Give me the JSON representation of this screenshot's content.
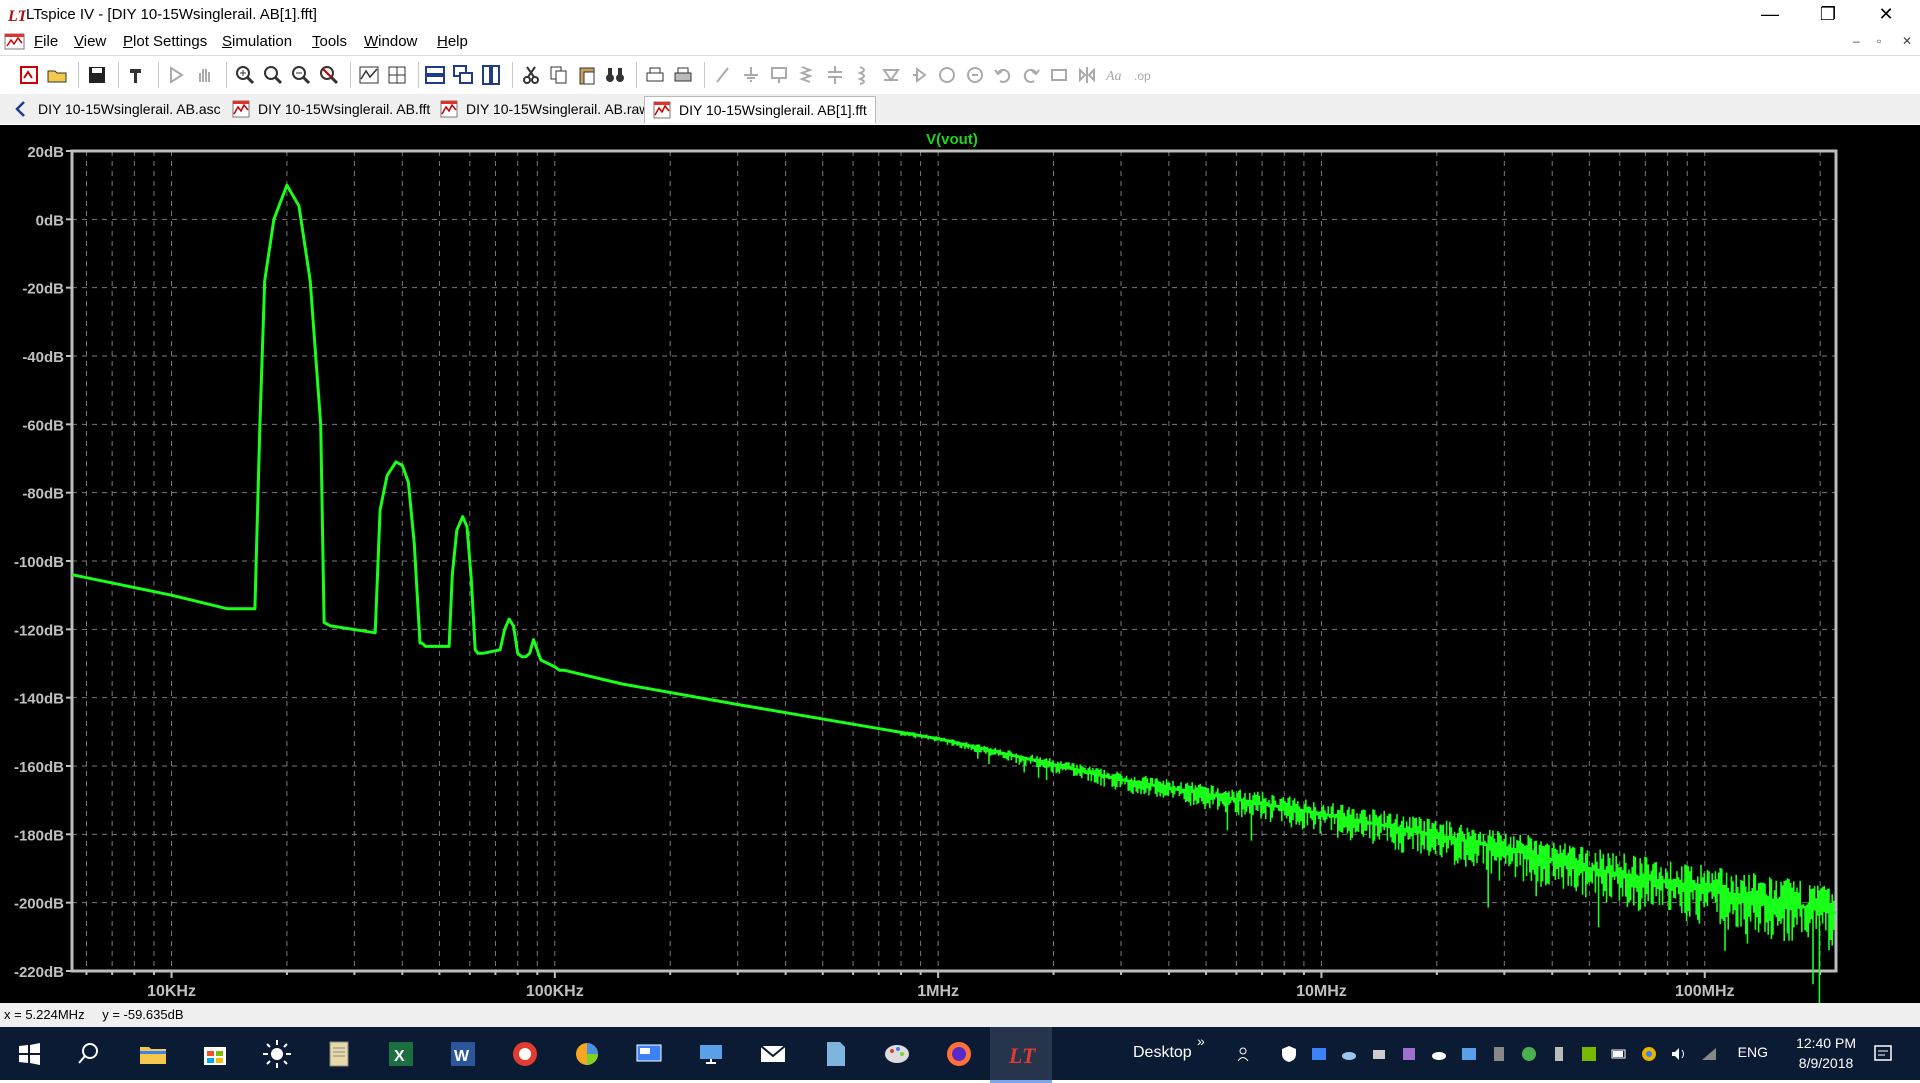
{
  "window": {
    "title": "LTspice IV - [DIY 10-15Wsinglerail. AB[1].fft]",
    "minimize": "—",
    "restore": "❐",
    "close": "✕"
  },
  "menu": {
    "items": [
      {
        "accel": "F",
        "rest": "ile"
      },
      {
        "accel": "V",
        "rest": "iew"
      },
      {
        "accel": "P",
        "rest": "lot Settings"
      },
      {
        "accel": "S",
        "rest": "imulation"
      },
      {
        "accel": "T",
        "rest": "ools"
      },
      {
        "accel": "W",
        "rest": "indow"
      },
      {
        "accel": "H",
        "rest": "elp"
      }
    ],
    "mdi_min": "–",
    "mdi_restore": "▫",
    "mdi_close": "✕"
  },
  "tabs": [
    {
      "label": "DIY 10-15Wsinglerail. AB.asc",
      "icon": "schematic-icon"
    },
    {
      "label": "DIY 10-15Wsinglerail. AB.fft",
      "icon": "waveform-icon"
    },
    {
      "label": "DIY 10-15Wsinglerail. AB.raw",
      "icon": "waveform-icon"
    },
    {
      "label": "DIY 10-15Wsinglerail. AB[1].fft",
      "icon": "waveform-icon",
      "active": true
    }
  ],
  "colors": {
    "trace": "#1aff1a",
    "trace_label": "#1fd21f",
    "grid": "#7a7a7a",
    "axis_text": "#c0c0c0",
    "plot_bg": "#000000"
  },
  "chart_data": {
    "type": "line",
    "title": "V(vout)",
    "xlabel": "",
    "ylabel": "",
    "x_scale": "log",
    "xlim": [
      5500,
      220000000
    ],
    "ylim": [
      -220,
      20
    ],
    "y_ticks": [
      "20dB",
      "0dB",
      "-20dB",
      "-40dB",
      "-60dB",
      "-80dB",
      "-100dB",
      "-120dB",
      "-140dB",
      "-160dB",
      "-180dB",
      "-200dB",
      "-220dB"
    ],
    "x_ticks": [
      {
        "value": 10000,
        "label": "10KHz"
      },
      {
        "value": 100000,
        "label": "100KHz"
      },
      {
        "value": 1000000,
        "label": "1MHz"
      },
      {
        "value": 10000000,
        "label": "10MHz"
      },
      {
        "value": 100000000,
        "label": "100MHz"
      }
    ],
    "grid": true,
    "series": [
      {
        "name": "V(vout)",
        "x": [
          5500,
          10000,
          14000,
          16500,
          17000,
          17500,
          18500,
          20000,
          21500,
          23000,
          24500,
          25000,
          26000,
          34000,
          35000,
          36500,
          38500,
          40000,
          41500,
          43000,
          44500,
          45000,
          46000,
          53000,
          54000,
          55500,
          57500,
          59000,
          60500,
          62000,
          63000,
          64000,
          65000,
          72000,
          74000,
          76000,
          78000,
          80000,
          82000,
          84000,
          86000,
          88000,
          92000,
          96000,
          100000,
          103000,
          106000,
          150000,
          300000,
          1000000,
          3000000,
          10000000,
          30000000,
          50000000,
          100000000,
          220000000
        ],
        "y": [
          -104,
          -110,
          -114,
          -114,
          -60,
          -18,
          0,
          10,
          4,
          -18,
          -60,
          -118,
          -119,
          -121,
          -85,
          -75,
          -71,
          -72,
          -77,
          -95,
          -124,
          -124,
          -125,
          -125,
          -104,
          -91,
          -87,
          -90,
          -105,
          -126,
          -127,
          -127,
          -127,
          -126,
          -120,
          -117,
          -119,
          -127,
          -128,
          -128,
          -127,
          -123,
          -129,
          -130,
          -131,
          -132,
          -132,
          -136,
          -142,
          -152,
          -164,
          -174,
          -184,
          -190,
          -196,
          -203
        ]
      }
    ]
  },
  "status": {
    "x_readout": "x = 5.224MHz",
    "y_readout": "y = -59.635dB"
  },
  "taskbar": {
    "desktop_label": "Desktop",
    "more": "»",
    "lang": "ENG",
    "time": "12:40 PM",
    "date": "8/9/2018"
  }
}
